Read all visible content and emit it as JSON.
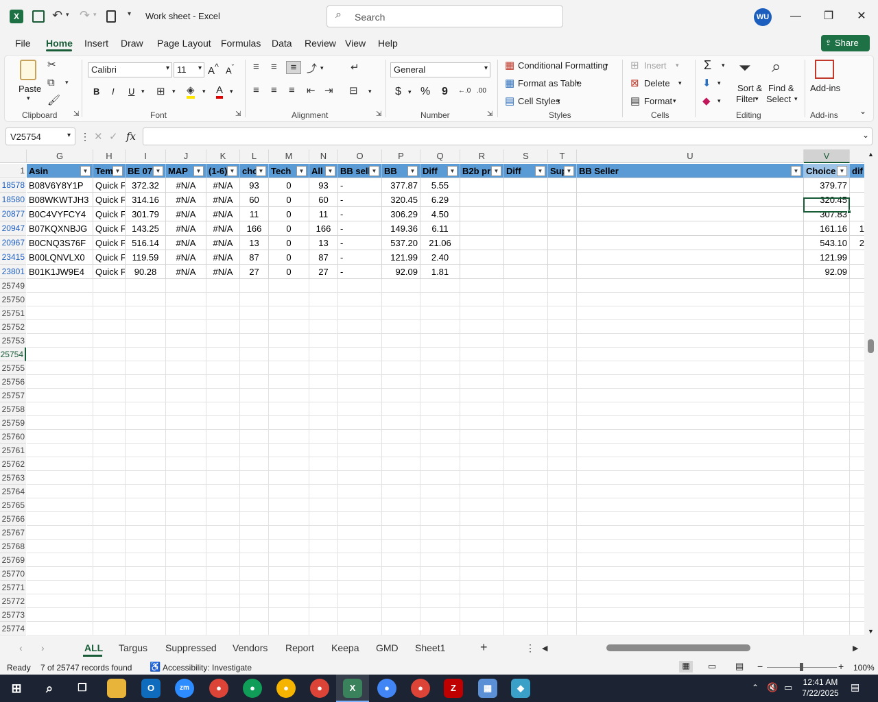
{
  "window": {
    "title": "Work sheet  -  Excel",
    "search_placeholder": "Search",
    "user_initials": "WU"
  },
  "menu": {
    "items": [
      "File",
      "Home",
      "Insert",
      "Draw",
      "Page Layout",
      "Formulas",
      "Data",
      "Review",
      "View",
      "Help"
    ],
    "share": "Share"
  },
  "ribbon": {
    "clipboard": {
      "label": "Clipboard",
      "paste": "Paste"
    },
    "font": {
      "label": "Font",
      "name": "Calibri",
      "size": "11",
      "bold": "B",
      "italic": "I",
      "underline": "U"
    },
    "alignment": {
      "label": "Alignment"
    },
    "number": {
      "label": "Number",
      "format": "General"
    },
    "styles": {
      "label": "Styles",
      "conditional": "Conditional Formatting",
      "format_table": "Format as Table",
      "cell_styles": "Cell Styles"
    },
    "cells": {
      "label": "Cells",
      "insert": "Insert",
      "delete": "Delete",
      "format": "Format"
    },
    "editing": {
      "label": "Editing",
      "sort1": "Sort &",
      "sort2": "Filter",
      "find1": "Find &",
      "find2": "Select"
    },
    "addins": {
      "label": "Add-ins",
      "btn": "Add-ins"
    }
  },
  "formula_bar": {
    "name_box": "V25754",
    "fx": "fx",
    "content": ""
  },
  "columns": [
    "G",
    "H",
    "I",
    "J",
    "K",
    "L",
    "M",
    "N",
    "O",
    "P",
    "Q",
    "R",
    "S",
    "T",
    "U",
    "V"
  ],
  "header_row": {
    "num": "1",
    "cells": [
      "Asin",
      "Tem",
      "BE 07.",
      "MAP",
      "(1-6)",
      "cho",
      "Tech",
      "All",
      "BB sell",
      "BB",
      "Diff",
      "B2b pr",
      "Diff",
      "Sup",
      "BB Seller",
      "Choice",
      "dif"
    ]
  },
  "rows": [
    {
      "num": "18578",
      "asin": "B08V6Y8Y1P",
      "tem": "Quick F",
      "be": "372.32",
      "map": "#N/A",
      "k": "#N/A",
      "cho": "93",
      "tech": "0",
      "all": "93",
      "bbsell": "-",
      "bb": "377.87",
      "diff": "5.55",
      "choice": "379.77",
      "extra": ""
    },
    {
      "num": "18580",
      "asin": "B08WKWTJH3",
      "tem": "Quick F",
      "be": "314.16",
      "map": "#N/A",
      "k": "#N/A",
      "cho": "60",
      "tech": "0",
      "all": "60",
      "bbsell": "-",
      "bb": "320.45",
      "diff": "6.29",
      "choice": "320.45",
      "extra": ""
    },
    {
      "num": "20877",
      "asin": "B0C4VYFCY4",
      "tem": "Quick F",
      "be": "301.79",
      "map": "#N/A",
      "k": "#N/A",
      "cho": "11",
      "tech": "0",
      "all": "11",
      "bbsell": "-",
      "bb": "306.29",
      "diff": "4.50",
      "choice": "307.83",
      "extra": ""
    },
    {
      "num": "20947",
      "asin": "B07KQXNBJG",
      "tem": "Quick F",
      "be": "143.25",
      "map": "#N/A",
      "k": "#N/A",
      "cho": "166",
      "tech": "0",
      "all": "166",
      "bbsell": "-",
      "bb": "149.36",
      "diff": "6.11",
      "choice": "161.16",
      "extra": "1"
    },
    {
      "num": "20967",
      "asin": "B0CNQ3S76F",
      "tem": "Quick F",
      "be": "516.14",
      "map": "#N/A",
      "k": "#N/A",
      "cho": "13",
      "tech": "0",
      "all": "13",
      "bbsell": "-",
      "bb": "537.20",
      "diff": "21.06",
      "choice": "543.10",
      "extra": "2"
    },
    {
      "num": "23415",
      "asin": "B00LQNVLX0",
      "tem": "Quick F",
      "be": "119.59",
      "map": "#N/A",
      "k": "#N/A",
      "cho": "87",
      "tech": "0",
      "all": "87",
      "bbsell": "-",
      "bb": "121.99",
      "diff": "2.40",
      "choice": "121.99",
      "extra": ""
    },
    {
      "num": "23801",
      "asin": "B01K1JW9E4",
      "tem": "Quick F",
      "be": "90.28",
      "map": "#N/A",
      "k": "#N/A",
      "cho": "27",
      "tech": "0",
      "all": "27",
      "bbsell": "-",
      "bb": "92.09",
      "diff": "1.81",
      "choice": "92.09",
      "extra": ""
    }
  ],
  "empty_rows": [
    "25749",
    "25750",
    "25751",
    "25752",
    "25753",
    "25754",
    "25755",
    "25756",
    "25757",
    "25758",
    "25759",
    "25760",
    "25761",
    "25762",
    "25763",
    "25764",
    "25765",
    "25766",
    "25767",
    "25768",
    "25769",
    "25770",
    "25771",
    "25772",
    "25773",
    "25774"
  ],
  "selected_row": "25754",
  "sheets": [
    "ALL",
    "Targus",
    "Suppressed",
    "Vendors",
    "Report",
    "Keepa",
    "GMD",
    "Sheet1"
  ],
  "status": {
    "ready": "Ready",
    "records": "7 of 25747 records found",
    "accessibility": "Accessibility: Investigate",
    "zoom": "100%"
  },
  "taskbar": {
    "time": "12:41 AM",
    "date": "7/22/2025"
  }
}
